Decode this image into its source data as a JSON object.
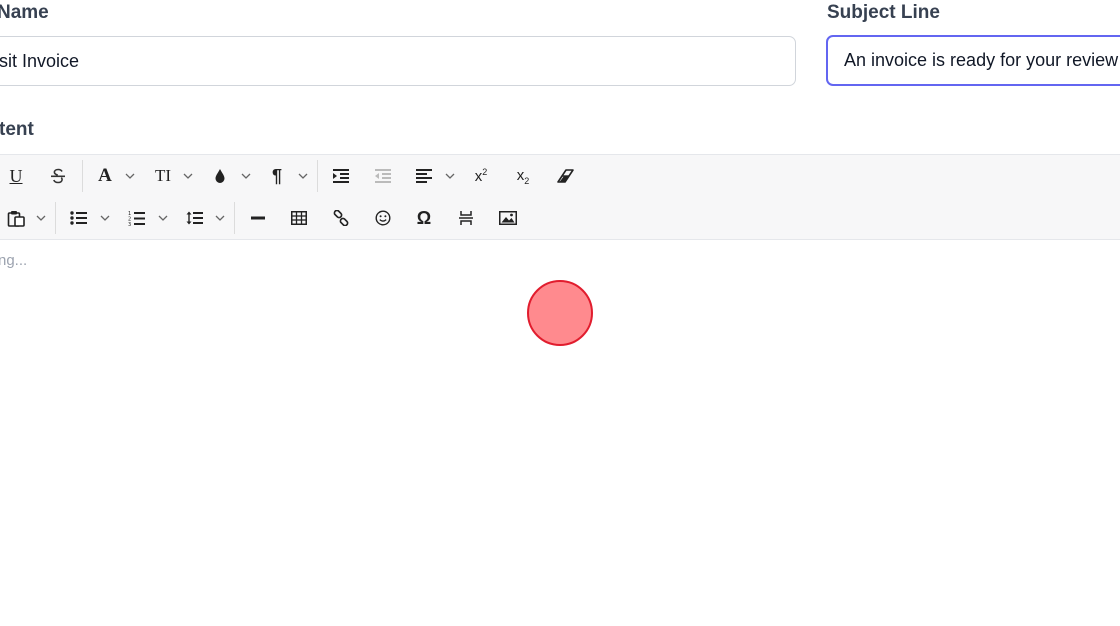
{
  "form": {
    "name_label": "Name",
    "name_value": "sit Invoice",
    "subject_label": "Subject Line",
    "subject_value": "An invoice is ready for your review",
    "content_label": "tent"
  },
  "toolbar": {
    "row1": [
      "underline",
      "strikethrough",
      "font-family",
      "font-size",
      "text-color",
      "paragraph-format",
      "indent",
      "outdent",
      "align",
      "superscript",
      "subscript",
      "clear-formatting"
    ],
    "row2": [
      "paste",
      "bulleted-list",
      "numbered-list",
      "line-height",
      "horizontal-line",
      "table",
      "link",
      "emoticons",
      "special-characters",
      "page-break",
      "image"
    ],
    "glyphs": {
      "underline": "U",
      "font_family": "A",
      "font_size": "TI",
      "paragraph": "¶",
      "superscript_base": "x",
      "superscript_exp": "2",
      "subscript_base": "x",
      "subscript_sub": "2",
      "omega": "Ω"
    }
  },
  "editor": {
    "placeholder": "ng..."
  },
  "colors": {
    "focus_border": "#6366f1",
    "cursor_fill": "#ff8a8e",
    "cursor_stroke": "#e11d2e"
  }
}
